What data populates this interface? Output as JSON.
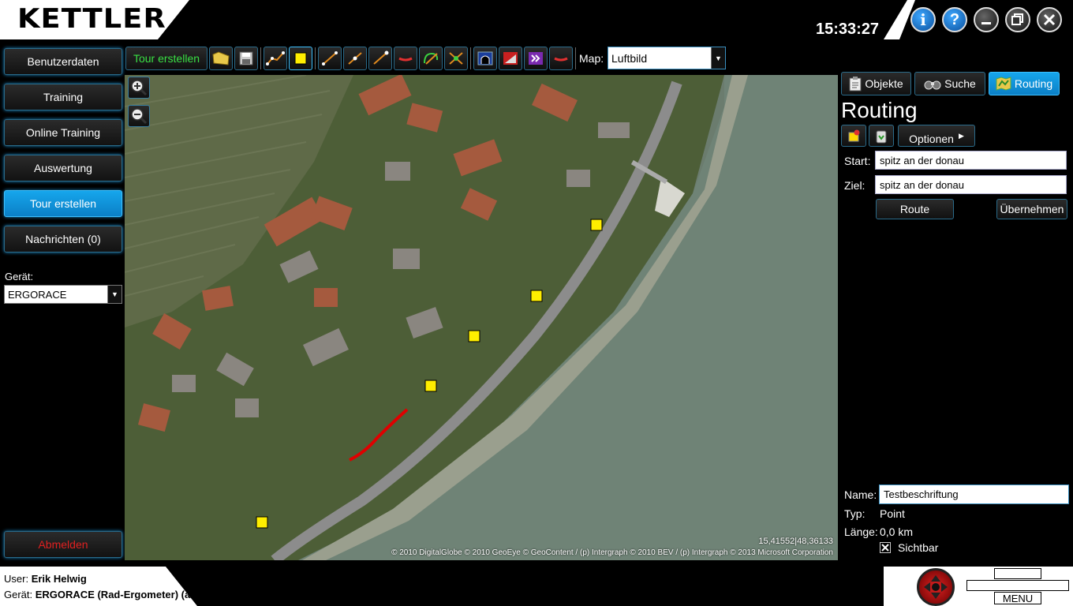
{
  "header": {
    "logo": "KETTLER",
    "clock": "15:33:27",
    "buttons": {
      "info": "i",
      "help": "?"
    }
  },
  "sidebar": {
    "items": [
      {
        "label": "Benutzerdaten"
      },
      {
        "label": "Training"
      },
      {
        "label": "Online Training"
      },
      {
        "label": "Auswertung"
      },
      {
        "label": "Tour erstellen"
      },
      {
        "label": "Nachrichten (0)"
      }
    ],
    "device_label": "Gerät:",
    "device_value": "ERGORACE",
    "logout": "Abmelden"
  },
  "toolbar": {
    "tour_label": "Tour erstellen",
    "map_label": "Map:",
    "map_value": "Luftbild"
  },
  "map": {
    "coordinates": "15,41552|48,36133",
    "attribution": "© 2010 DigitalGlobe © 2010 GeoEye © GeoContent / (p) Intergraph © 2010 BEV / (p) Intergraph © 2013 Microsoft Corporation"
  },
  "panel": {
    "tabs": [
      {
        "label": "Objekte"
      },
      {
        "label": "Suche"
      },
      {
        "label": "Routing"
      }
    ],
    "title": "Routing",
    "options_label": "Optionen",
    "start_label": "Start:",
    "start_value": "spitz an der donau",
    "ziel_label": "Ziel:",
    "ziel_value": "spitz an der donau",
    "route_button": "Route",
    "apply_button": "Übernehmen",
    "name_label": "Name:",
    "name_value": "Testbeschriftung",
    "typ_label": "Typ:",
    "typ_value": "Point",
    "laenge_label": "Länge:",
    "laenge_value": "0,0 km",
    "visible_label": "Sichtbar",
    "visible_checked": true
  },
  "footer": {
    "user_label": "User:",
    "user_value": "Erik Helwig",
    "device_label": "Gerät:",
    "device_value": "ERGORACE (Rad-Ergometer) (außer Betrieb)",
    "menu_label": "MENU"
  },
  "colors": {
    "accent": "#0b8fd6",
    "toolbar_text": "#39e044",
    "logout": "#e02020",
    "marker": "#ffee00",
    "route": "#e00000"
  }
}
